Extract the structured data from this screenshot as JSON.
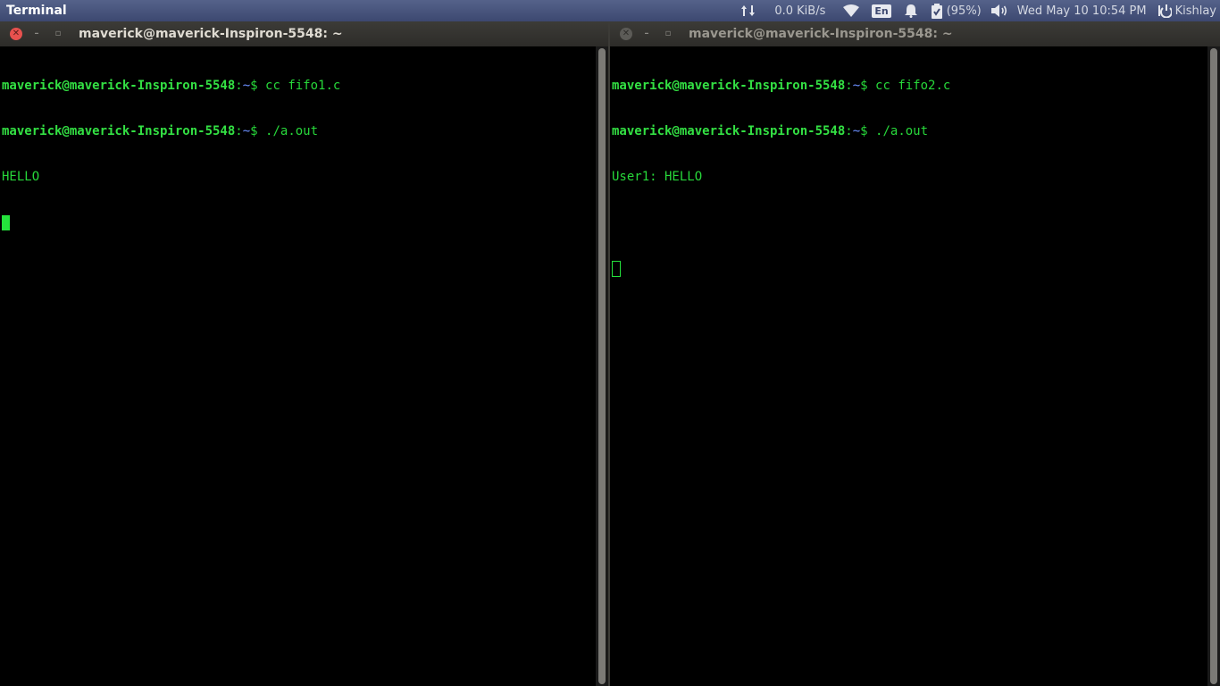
{
  "topbar": {
    "app_title": "Terminal",
    "net_speed": "0.0 KiB/s",
    "lang": "En",
    "battery_percent": "(95%)",
    "clock": "Wed May 10 10:54 PM",
    "user": "Kishlay",
    "icons": [
      "network-updown-icon",
      "wifi-icon",
      "keyboard-lang-icon",
      "notification-bell-icon",
      "battery-icon",
      "volume-icon",
      "session-power-icon"
    ]
  },
  "windows": [
    {
      "title": "maverick@maverick-Inspiron-5548: ~",
      "focused": true,
      "lines": [
        {
          "user": "maverick@maverick-Inspiron-5548",
          "sep": ":",
          "path": "~",
          "tail": "$ cc fifo1.c"
        },
        {
          "user": "maverick@maverick-Inspiron-5548",
          "sep": ":",
          "path": "~",
          "tail": "$ ./a.out"
        },
        {
          "output": "HELLO"
        }
      ]
    },
    {
      "title": "maverick@maverick-Inspiron-5548: ~",
      "focused": false,
      "lines": [
        {
          "user": "maverick@maverick-Inspiron-5548",
          "sep": ":",
          "path": "~",
          "tail": "$ cc fifo2.c"
        },
        {
          "user": "maverick@maverick-Inspiron-5548",
          "sep": ":",
          "path": "~",
          "tail": "$ ./a.out"
        },
        {
          "output": "User1: HELLO"
        },
        {
          "output": ""
        }
      ]
    }
  ],
  "colors": {
    "prompt_green": "#33e043",
    "path_blue": "#6b8fff",
    "text_green": "#27d83a",
    "panel_bg": "#3d4870",
    "titlebar_bg": "#3c3b37"
  }
}
